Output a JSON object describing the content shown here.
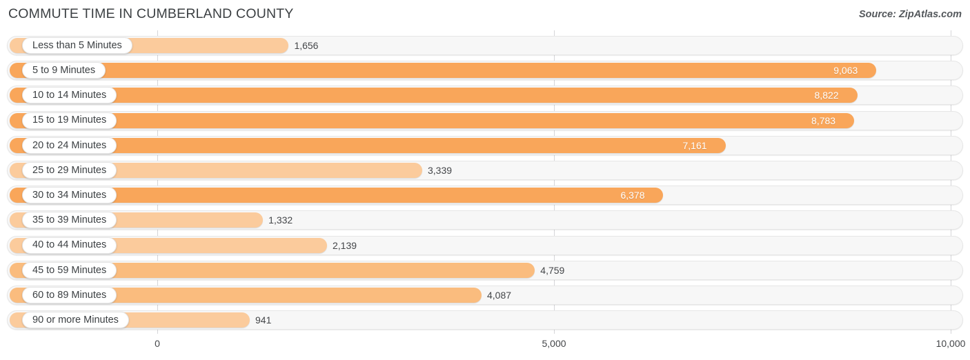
{
  "header": {
    "title": "COMMUTE TIME IN CUMBERLAND COUNTY",
    "source": "Source: ZipAtlas.com"
  },
  "colors": {
    "bar_light": "#fbcb9c",
    "bar_medium": "#fabc7e",
    "bar_strong": "#f9a65a",
    "track": "#f7f7f7",
    "gridline": "#d5d5d8",
    "text": "#3c4043"
  },
  "chart_data": {
    "type": "bar",
    "orientation": "horizontal",
    "title": "COMMUTE TIME IN CUMBERLAND COUNTY",
    "xlabel": "",
    "ylabel": "",
    "xlim": [
      0,
      10000
    ],
    "ticks": [
      "0",
      "5,000",
      "10,000"
    ],
    "tick_values": [
      0,
      5000,
      10000
    ],
    "grid": true,
    "legend": false,
    "categories": [
      "Less than 5 Minutes",
      "5 to 9 Minutes",
      "10 to 14 Minutes",
      "15 to 19 Minutes",
      "20 to 24 Minutes",
      "25 to 29 Minutes",
      "30 to 34 Minutes",
      "35 to 39 Minutes",
      "40 to 44 Minutes",
      "45 to 59 Minutes",
      "60 to 89 Minutes",
      "90 or more Minutes"
    ],
    "values": [
      1656,
      9063,
      8822,
      8783,
      7161,
      3339,
      6378,
      1332,
      2139,
      4759,
      4087,
      941
    ],
    "value_labels": [
      "1,656",
      "9,063",
      "8,822",
      "8,783",
      "7,161",
      "3,339",
      "6,378",
      "1,332",
      "2,139",
      "4,759",
      "4,087",
      "941"
    ]
  }
}
